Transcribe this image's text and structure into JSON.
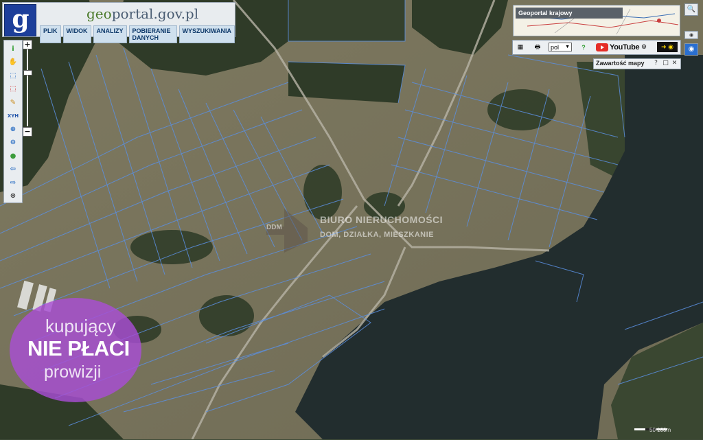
{
  "header": {
    "logo_letter": "g",
    "site_title_prefix": "geo",
    "site_title_rest": "portal.gov.pl",
    "menu": [
      "PLIK",
      "WIDOK",
      "ANALIZY",
      "POBIERANIE DANYCH",
      "WYSZUKIWANIA"
    ]
  },
  "toolbar": {
    "tools": [
      {
        "name": "info-icon",
        "glyph": "i",
        "color": "#2e9c2e"
      },
      {
        "name": "pan-hand-icon",
        "glyph": "✋",
        "color": "#c68a3a"
      },
      {
        "name": "select-area-icon",
        "glyph": "⬚",
        "color": "#2c6fc4"
      },
      {
        "name": "select-red-icon",
        "glyph": "⬚",
        "color": "#d02b2b"
      },
      {
        "name": "pencil-icon",
        "glyph": "✎",
        "color": "#c98a1a"
      },
      {
        "name": "xyh-icon",
        "glyph": "XYH",
        "color": "#2255aa"
      },
      {
        "name": "zoom-in-icon",
        "glyph": "⊕",
        "color": "#2c6fc4"
      },
      {
        "name": "zoom-out-icon",
        "glyph": "⊖",
        "color": "#2c6fc4"
      },
      {
        "name": "globe-icon",
        "glyph": "●",
        "color": "#3c9c3c"
      },
      {
        "name": "arrow-back-icon",
        "glyph": "⇦",
        "color": "#2c6fc4"
      },
      {
        "name": "arrow-forward-icon",
        "glyph": "⇨",
        "color": "#2c6fc4"
      },
      {
        "name": "crosshair-icon",
        "glyph": "⊗",
        "color": "#444444"
      }
    ]
  },
  "zoom": {
    "plus": "+",
    "minus": "−"
  },
  "overview": {
    "label": "Geoportal krajowy"
  },
  "right_buttons": [
    "🔍",
    "◉",
    "◉"
  ],
  "controlbar": {
    "language": "pol",
    "youtube_label": "YouTube"
  },
  "panel": {
    "title": "Zawartość mapy",
    "help": "?",
    "restore": "□",
    "close": "✕"
  },
  "watermark": {
    "ddm": "DDM",
    "line1": "BIURO NIERUCHOMOŚCI",
    "line2": "DOM, DZIAŁKA, MIESZKANIE"
  },
  "promo": {
    "line1": "kupujący",
    "line2": "NIE PŁACI",
    "line3": "prowizji"
  },
  "scale": {
    "label": "50 100m"
  },
  "colors": {
    "parcel_line": "#5b8fe0",
    "forest": "#2f3b28",
    "field": "#8a8466",
    "lake": "#1f2a2b",
    "promo": "#a84ed4",
    "header_blue": "#1d3f9a"
  }
}
